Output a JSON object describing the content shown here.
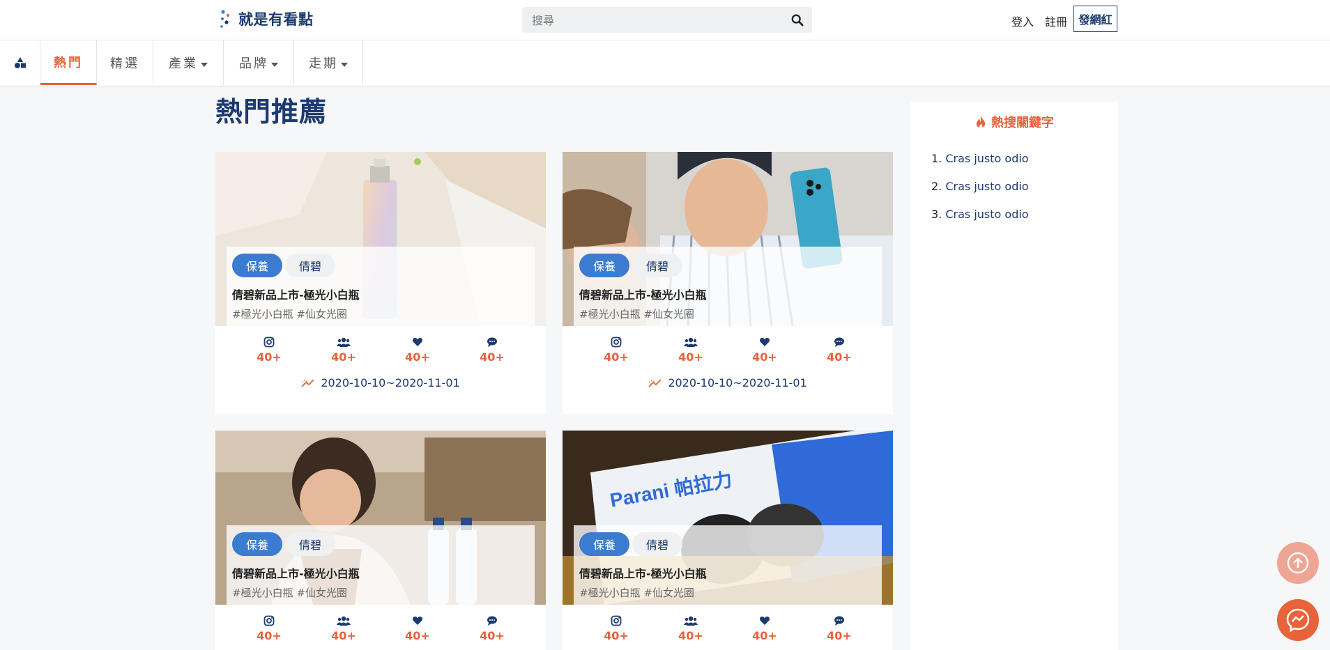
{
  "header": {
    "brand": "就是有看點",
    "search_placeholder": "搜尋",
    "login": "登入",
    "register": "註冊",
    "influencer_button": "發網紅"
  },
  "tabs": [
    {
      "label": "熱門",
      "active": true,
      "dropdown": false
    },
    {
      "label": "精選",
      "active": false,
      "dropdown": false
    },
    {
      "label": "產業",
      "active": false,
      "dropdown": true
    },
    {
      "label": "品牌",
      "active": false,
      "dropdown": true
    },
    {
      "label": "走期",
      "active": false,
      "dropdown": true
    }
  ],
  "main": {
    "title": "熱門推薦",
    "cards": [
      {
        "chip_primary": "保養",
        "chip_secondary": "倩碧",
        "title": "倩碧新品上市-極光小白瓶",
        "tags": "#極光小白瓶 #仙女光圈",
        "stats": [
          "40+",
          "40+",
          "40+",
          "40+"
        ],
        "period": "2020-10-10~2020-11-01",
        "image": "skincare-bottle-photo"
      },
      {
        "chip_primary": "保養",
        "chip_secondary": "倩碧",
        "title": "倩碧新品上市-極光小白瓶",
        "tags": "#極光小白瓶 #仙女光圈",
        "stats": [
          "40+",
          "40+",
          "40+",
          "40+"
        ],
        "period": "2020-10-10~2020-11-01",
        "image": "man-with-phone-photo"
      },
      {
        "chip_primary": "保養",
        "chip_secondary": "倩碧",
        "title": "倩碧新品上市-極光小白瓶",
        "tags": "#極光小白瓶 #仙女光圈",
        "stats": [
          "40+",
          "40+",
          "40+",
          "40+"
        ],
        "image": "woman-cafe-photo"
      },
      {
        "chip_primary": "保養",
        "chip_secondary": "倩碧",
        "title": "倩碧新品上市-極光小白瓶",
        "tags": "#極光小白瓶 #仙女光圈",
        "stats": [
          "40+",
          "40+",
          "40+",
          "40+"
        ],
        "image": "parani-box-photo",
        "box_text": "Parani 帕拉力"
      }
    ],
    "stat_icons": [
      "instagram-icon",
      "users-icon",
      "heart-icon",
      "comment-icon"
    ]
  },
  "sidebar": {
    "title": "熱搜關鍵字",
    "keywords": [
      "Cras justo odio",
      "Cras justo odio",
      "Cras justo odio"
    ]
  },
  "colors": {
    "brand": "#1d3a70",
    "accent": "#e8623a",
    "chip": "#3b7bd0"
  }
}
